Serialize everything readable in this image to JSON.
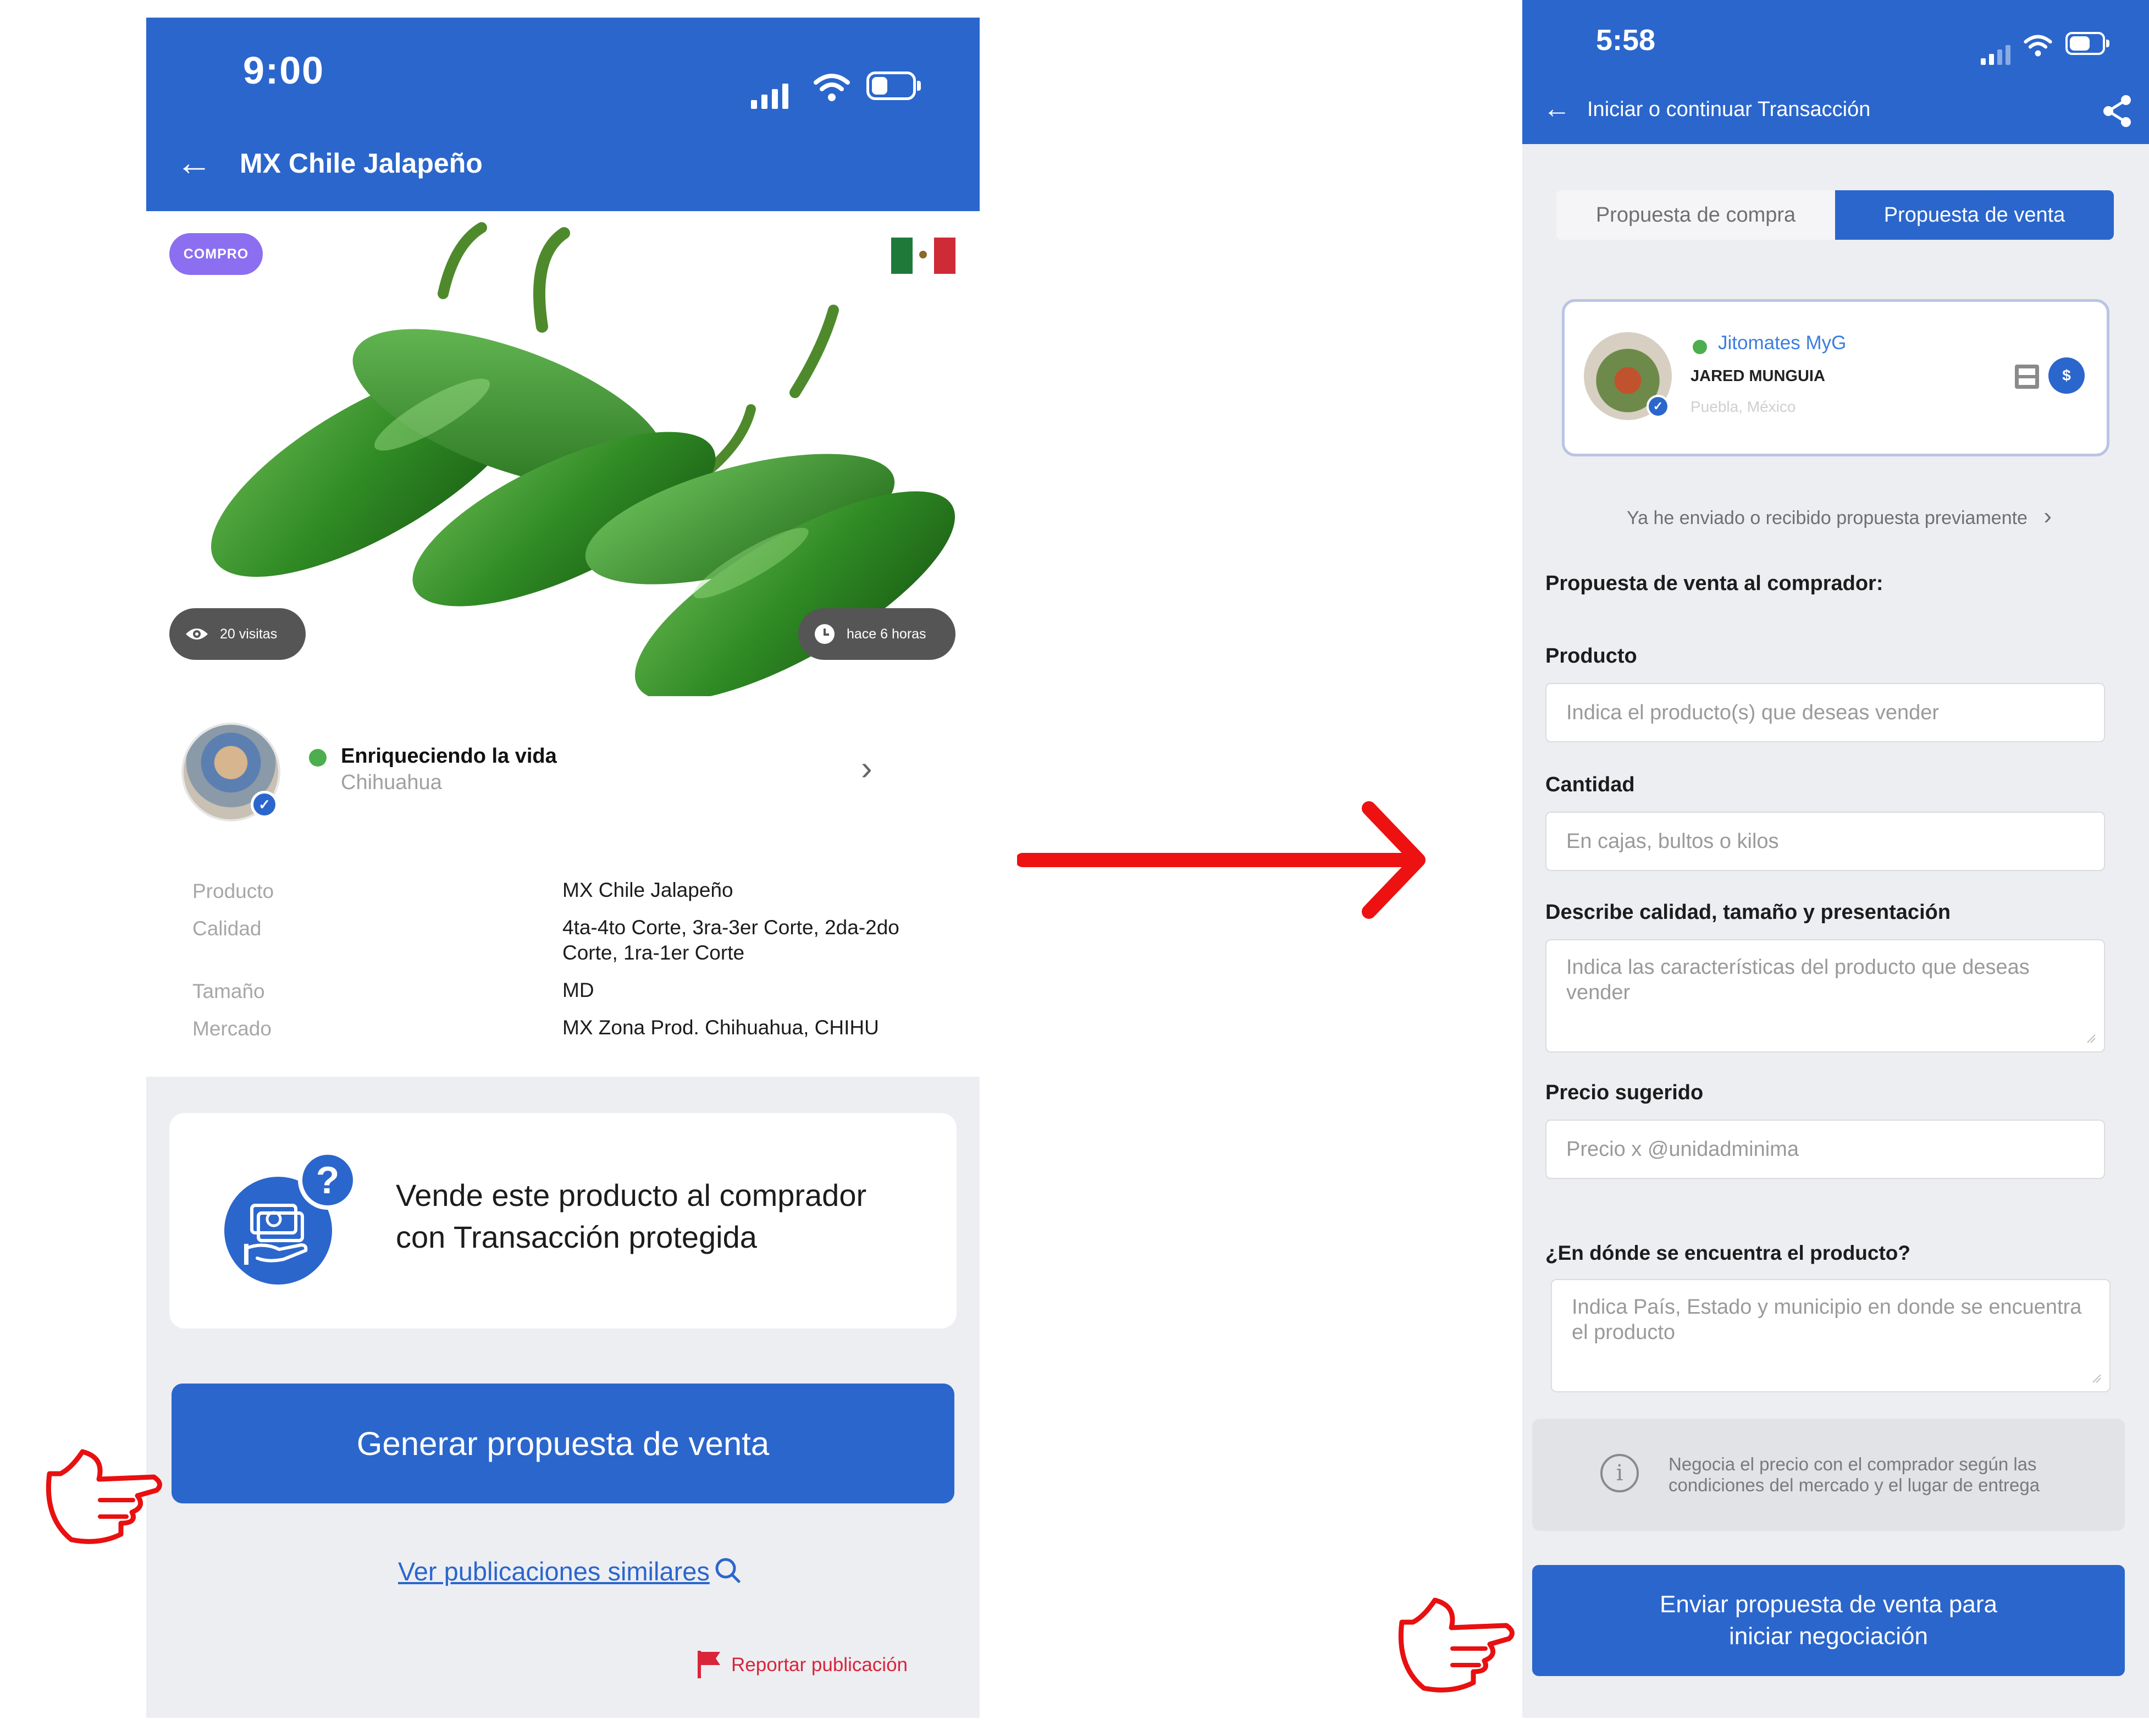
{
  "left_screen": {
    "status_bar": {
      "time": "9:00"
    },
    "header": {
      "title": "MX Chile Jalapeño"
    },
    "badge": "COMPRO",
    "stats": {
      "views": "20 visitas",
      "posted": "hace 6 horas"
    },
    "seller": {
      "name": "Enriqueciendo la vida",
      "city": "Chihuahua"
    },
    "specs": [
      {
        "key": "Producto",
        "value": "MX Chile Jalapeño"
      },
      {
        "key": "Calidad",
        "value": "4ta-4to Corte, 3ra-3er Corte, 2da-2do Corte, 1ra-1er Corte"
      },
      {
        "key": "Tamaño",
        "value": "MD"
      },
      {
        "key": "Mercado",
        "value": "MX Zona Prod. Chihuahua, CHIHU"
      }
    ],
    "promo": {
      "text": "Vende este producto al comprador con Transacción protegida"
    },
    "cta": {
      "label": "Generar propuesta de venta"
    },
    "similar_link": "Ver publicaciones similares",
    "report_link": "Reportar publicación"
  },
  "right_screen": {
    "status_bar": {
      "time": "5:58"
    },
    "header": {
      "title": "Iniciar o continuar Transacción"
    },
    "tabs": {
      "buy": "Propuesta de compra",
      "sell": "Propuesta de venta"
    },
    "buyer_card": {
      "business": "Jitomates MyG",
      "person": "JARED MUNGUIA",
      "location": "Puebla, México"
    },
    "previous_link": "Ya he enviado o recibido propuesta previamente",
    "section_title": "Propuesta de venta  al comprador:",
    "form": {
      "producto": {
        "label": "Producto",
        "placeholder": "Indica el producto(s) que deseas vender"
      },
      "cantidad": {
        "label": "Cantidad",
        "placeholder": "En cajas, bultos o kilos"
      },
      "calidad": {
        "label": "Describe calidad, tamaño y presentación",
        "placeholder": "Indica las características del producto que deseas vender"
      },
      "precio": {
        "label": "Precio sugerido",
        "placeholder": "Precio x @unidadminima"
      },
      "ubicacion": {
        "label": "¿En dónde se encuentra el producto?",
        "placeholder": "Indica País, Estado y municipio en donde se encuentra el producto"
      }
    },
    "info": "Negocia el precio con el comprador según las condiciones del mercado y el lugar de entrega",
    "submit": {
      "line1": "Enviar propuesta de venta para",
      "line2": "iniciar negociación"
    }
  },
  "colors": {
    "primary": "#2b66cc",
    "badge": "#8b6ff0",
    "report": "#d9243a",
    "arrow": "#ee1111",
    "online": "#4cae4c"
  }
}
